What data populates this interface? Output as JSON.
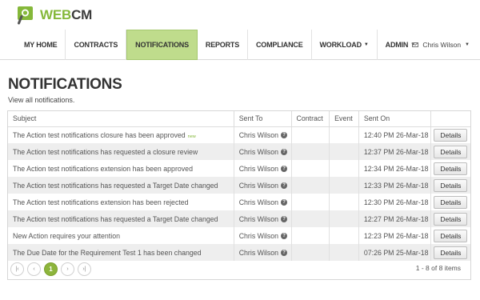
{
  "logo": {
    "text_w": "WEB",
    "text_c": "CM"
  },
  "nav": {
    "items": [
      {
        "label": "My Home"
      },
      {
        "label": "Contracts"
      },
      {
        "label": "Notifications"
      },
      {
        "label": "Reports"
      },
      {
        "label": "Compliance"
      },
      {
        "label": "Workload",
        "dropdown": true
      },
      {
        "label": "Admin",
        "dropdown": true
      }
    ],
    "active_index": 2
  },
  "user": {
    "name": "Chris Wilson",
    "icon": "envelope-icon"
  },
  "page": {
    "title": "NOTIFICATIONS",
    "subtitle": "View all notifications."
  },
  "table": {
    "columns": [
      "Subject",
      "Sent To",
      "Contract",
      "Event",
      "Sent On",
      ""
    ],
    "rows": [
      {
        "subject": "The Action test notifications closure has been approved",
        "new": "new",
        "sent_to": "Chris Wilson",
        "contract": "",
        "event": "",
        "sent_on": "12:40 PM 26-Mar-18",
        "action": "Details"
      },
      {
        "subject": "The Action test notifications has requested a closure review",
        "sent_to": "Chris Wilson",
        "contract": "",
        "event": "",
        "sent_on": "12:37 PM 26-Mar-18",
        "action": "Details"
      },
      {
        "subject": "The Action test notifications extension has been approved",
        "sent_to": "Chris Wilson",
        "contract": "",
        "event": "",
        "sent_on": "12:34 PM 26-Mar-18",
        "action": "Details"
      },
      {
        "subject": "The Action test notifications has requested a Target Date changed",
        "sent_to": "Chris Wilson",
        "contract": "",
        "event": "",
        "sent_on": "12:33 PM 26-Mar-18",
        "action": "Details"
      },
      {
        "subject": "The Action test notifications extension has been rejected",
        "sent_to": "Chris Wilson",
        "contract": "",
        "event": "",
        "sent_on": "12:30 PM 26-Mar-18",
        "action": "Details"
      },
      {
        "subject": "The Action test notifications has requested a Target Date changed",
        "sent_to": "Chris Wilson",
        "contract": "",
        "event": "",
        "sent_on": "12:27 PM 26-Mar-18",
        "action": "Details"
      },
      {
        "subject": "New Action requires your attention",
        "sent_to": "Chris Wilson",
        "contract": "",
        "event": "",
        "sent_on": "12:23 PM 26-Mar-18",
        "action": "Details"
      },
      {
        "subject": "The Due Date for the Requirement Test 1 has been changed",
        "sent_to": "Chris Wilson",
        "contract": "",
        "event": "",
        "sent_on": "07:26 PM 25-Mar-18",
        "action": "Details"
      }
    ]
  },
  "pager": {
    "first": "|‹",
    "prev": "‹",
    "current": "1",
    "next": "›",
    "last": "›|",
    "summary": "1 - 8 of 8 items"
  },
  "colors": {
    "brand_green": "#85b83a",
    "active_nav_bg": "#bfdc8c",
    "pager_active": "#8db53c"
  }
}
